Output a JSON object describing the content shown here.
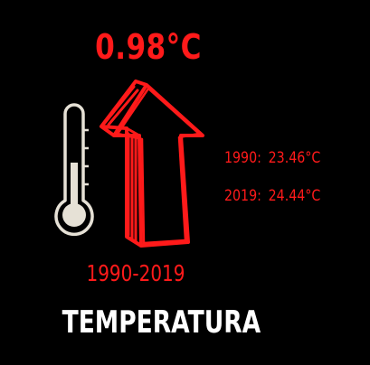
{
  "headline": {
    "change_value": "0.98°C",
    "color": "#ff1a1a"
  },
  "stats": [
    {
      "year": "1990:",
      "value": "23.46°C"
    },
    {
      "year": "2019:",
      "value": "24.44°C"
    }
  ],
  "period": "1990-2019",
  "title": "TEMPERATURA",
  "icons": {
    "thermometer": "thermometer-icon",
    "arrow": "up-arrow-icon"
  },
  "colors": {
    "background": "#000000",
    "accent": "#ff1a1a",
    "title": "#ffffff",
    "thermometer": "#e6e1d6"
  }
}
